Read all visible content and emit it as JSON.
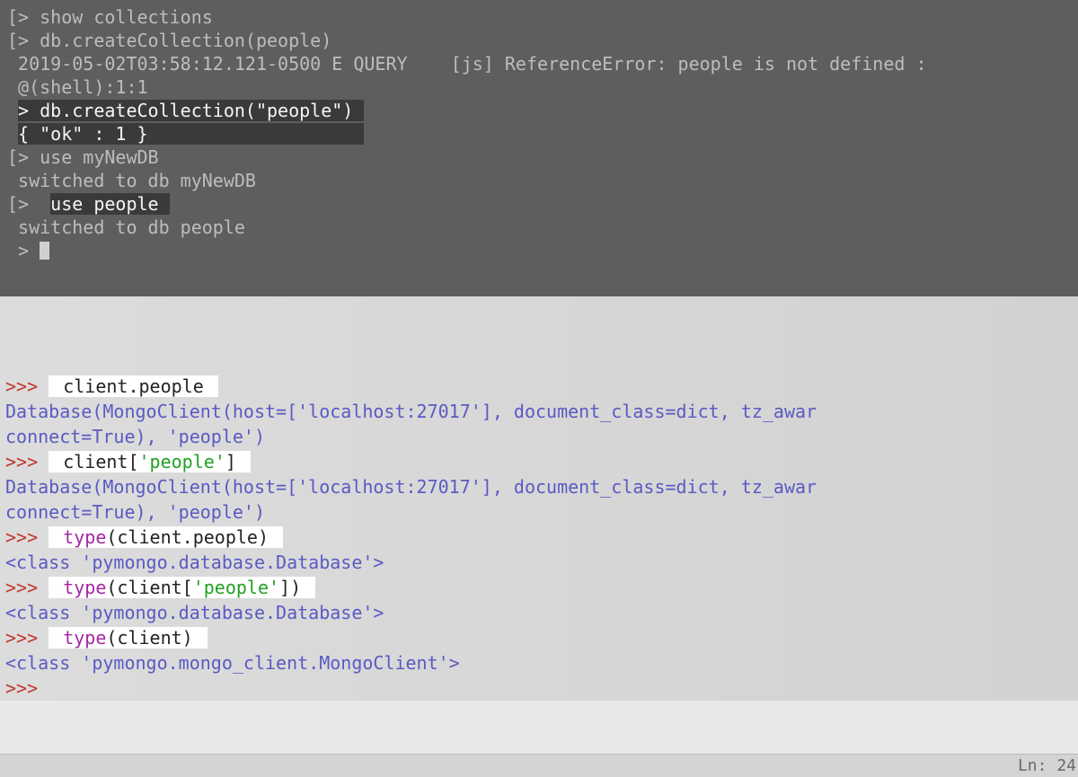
{
  "terminal": {
    "lines": [
      {
        "prefix": "[> ",
        "text": "show collections",
        "style": "dim"
      },
      {
        "prefix": "[> ",
        "text": "db.createCollection(people)",
        "style": "dim"
      },
      {
        "prefix": " ",
        "text": "2019-05-02T03:58:12.121-0500 E QUERY    [js] ReferenceError: people is not defined :",
        "style": "dim"
      },
      {
        "prefix": " ",
        "text": "@(shell):1:1",
        "style": "dim"
      },
      {
        "prefix": " ",
        "text": "> db.createCollection(\"people\") ",
        "style": "hilite"
      },
      {
        "prefix": " ",
        "text": "{ \"ok\" : 1 }                    ",
        "style": "hilite"
      },
      {
        "prefix": "[> ",
        "text": "use myNewDB",
        "style": "dim"
      },
      {
        "prefix": " ",
        "text": "switched to db myNewDB",
        "style": "dim"
      },
      {
        "prefix": "[> ",
        "text_pre": " ",
        "text": "use people ",
        "style": "hilite-inline"
      },
      {
        "prefix": " ",
        "text": "switched to db people",
        "style": "dim"
      },
      {
        "prefix": " > ",
        "text": "",
        "style": "cursor"
      }
    ]
  },
  "python": {
    "partial_top": ">>> ",
    "rows": [
      {
        "prompt": ">>> ",
        "code_plain": "client.people"
      },
      {
        "out": "Database(MongoClient(host=['localhost:27017'], document_class=dict, tz_awar"
      },
      {
        "out": "connect=True), 'people')"
      },
      {
        "prompt": ">>> ",
        "code_parts": [
          {
            "t": "client[",
            "c": "plain"
          },
          {
            "t": "'people'",
            "c": "str"
          },
          {
            "t": "]",
            "c": "plain"
          }
        ]
      },
      {
        "out": "Database(MongoClient(host=['localhost:27017'], document_class=dict, tz_awar"
      },
      {
        "out": "connect=True), 'people')"
      },
      {
        "prompt": ">>> ",
        "code_parts": [
          {
            "t": "type",
            "c": "kw"
          },
          {
            "t": "(client.people)",
            "c": "plain"
          }
        ]
      },
      {
        "out": "<class 'pymongo.database.Database'>"
      },
      {
        "prompt": ">>> ",
        "code_parts": [
          {
            "t": "type",
            "c": "kw"
          },
          {
            "t": "(client[",
            "c": "plain"
          },
          {
            "t": "'people'",
            "c": "str"
          },
          {
            "t": "])",
            "c": "plain"
          }
        ]
      },
      {
        "out": "<class 'pymongo.database.Database'>"
      },
      {
        "prompt": ">>> ",
        "code_parts": [
          {
            "t": "type",
            "c": "kw"
          },
          {
            "t": "(client)",
            "c": "plain"
          }
        ]
      },
      {
        "out": "<class 'pymongo.mongo_client.MongoClient'>"
      },
      {
        "prompt": ">>>"
      }
    ]
  },
  "status": {
    "text": "Ln: 24"
  }
}
